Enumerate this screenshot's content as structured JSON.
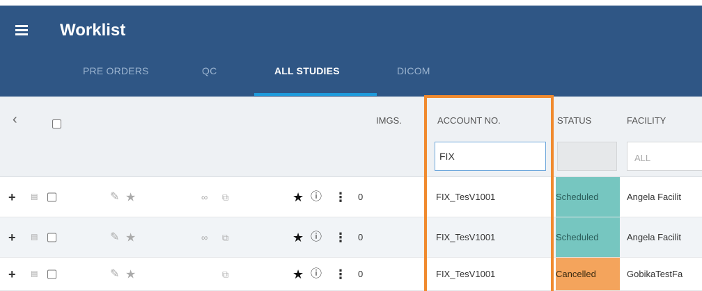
{
  "header": {
    "title": "Worklist",
    "tabs": [
      {
        "label": "PRE ORDERS",
        "active": false
      },
      {
        "label": "QC",
        "active": false
      },
      {
        "label": "ALL STUDIES",
        "active": true
      },
      {
        "label": "DICOM",
        "active": false
      }
    ]
  },
  "table": {
    "columns": {
      "imgs": "IMGS.",
      "account": "ACCOUNT NO.",
      "status": "STATUS",
      "facility": "FACILITY"
    },
    "filters": {
      "account_value": "FIX",
      "facility_value": "ALL"
    },
    "rows": [
      {
        "imgs": "0",
        "account": "FIX_TesV1001",
        "status": "Scheduled",
        "facility": "Angela Facilit"
      },
      {
        "imgs": "0",
        "account": "FIX_TesV1001",
        "status": "Scheduled",
        "facility": "Angela Facilit"
      },
      {
        "imgs": "0",
        "account": "FIX_TesV1001",
        "status": "Cancelled",
        "facility": "GobikaTestFa"
      }
    ]
  },
  "colors": {
    "header_bg": "#2f5685",
    "tab_accent": "#1e9bdc",
    "highlight_border": "#f08a2e",
    "scheduled": "#76c6c0",
    "cancelled": "#f4a45c"
  },
  "icons": [
    "hamburger-menu-icon",
    "back-chevron-icon",
    "expand-plus-icon",
    "document-icon",
    "pencil-icon",
    "star-icon",
    "link-icon",
    "share-icon",
    "info-icon",
    "kebab-menu-icon"
  ]
}
